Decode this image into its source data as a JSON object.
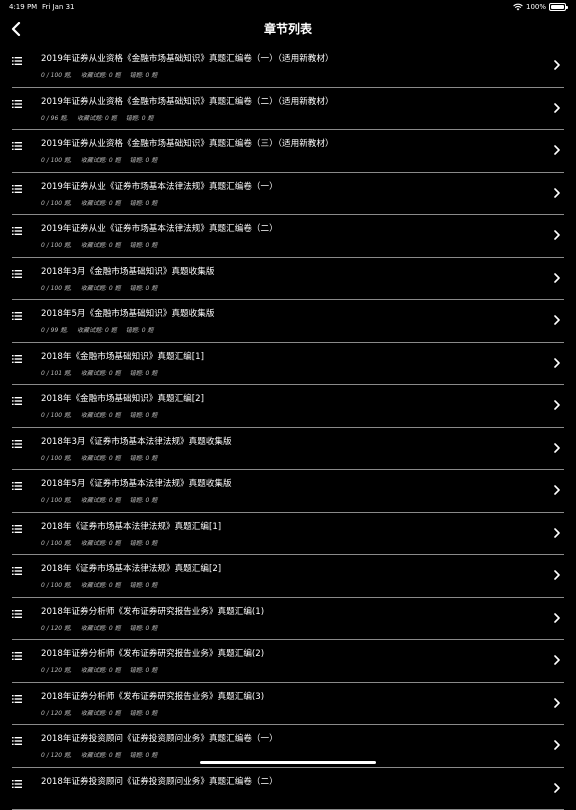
{
  "status": {
    "time": "4:19 PM",
    "date": "Fri Jan 31",
    "battery": "100%"
  },
  "nav": {
    "title": "章节列表"
  },
  "chapters": [
    {
      "title": "2019年证券从业资格《金融市场基础知识》真题汇编卷（一）（适用新教材）",
      "progress": "0 / 100 题,",
      "favorites": "收藏试题: 0 题",
      "wrong": "错题: 0 题"
    },
    {
      "title": "2019年证券从业资格《金融市场基础知识》真题汇编卷（二）（适用新教材）",
      "progress": "0 / 96 题,",
      "favorites": "收藏试题: 0 题",
      "wrong": "错题: 0 题"
    },
    {
      "title": "2019年证券从业资格《金融市场基础知识》真题汇编卷（三）（适用新教材）",
      "progress": "0 / 100 题,",
      "favorites": "收藏试题: 0 题",
      "wrong": "错题: 0 题"
    },
    {
      "title": "2019年证券从业《证券市场基本法律法规》真题汇编卷（一）",
      "progress": "0 / 100 题,",
      "favorites": "收藏试题: 0 题",
      "wrong": "错题: 0 题"
    },
    {
      "title": "2019年证券从业《证券市场基本法律法规》真题汇编卷（二）",
      "progress": "0 / 100 题,",
      "favorites": "收藏试题: 0 题",
      "wrong": "错题: 0 题"
    },
    {
      "title": "2018年3月《金融市场基础知识》真题收集版",
      "progress": "0 / 100 题,",
      "favorites": "收藏试题: 0 题",
      "wrong": "错题: 0 题"
    },
    {
      "title": "2018年5月《金融市场基础知识》真题收集版",
      "progress": "0 / 99 题,",
      "favorites": "收藏试题: 0 题",
      "wrong": "错题: 0 题"
    },
    {
      "title": "2018年《金融市场基础知识》真题汇编[1]",
      "progress": "0 / 101 题,",
      "favorites": "收藏试题: 0 题",
      "wrong": "错题: 0 题"
    },
    {
      "title": "2018年《金融市场基础知识》真题汇编[2]",
      "progress": "0 / 100 题,",
      "favorites": "收藏试题: 0 题",
      "wrong": "错题: 0 题"
    },
    {
      "title": "2018年3月《证券市场基本法律法规》真题收集版",
      "progress": "0 / 100 题,",
      "favorites": "收藏试题: 0 题",
      "wrong": "错题: 0 题"
    },
    {
      "title": "2018年5月《证券市场基本法律法规》真题收集版",
      "progress": "0 / 100 题,",
      "favorites": "收藏试题: 0 题",
      "wrong": "错题: 0 题"
    },
    {
      "title": "2018年《证券市场基本法律法规》真题汇编[1]",
      "progress": "0 / 100 题,",
      "favorites": "收藏试题: 0 题",
      "wrong": "错题: 0 题"
    },
    {
      "title": "2018年《证券市场基本法律法规》真题汇编[2]",
      "progress": "0 / 100 题,",
      "favorites": "收藏试题: 0 题",
      "wrong": "错题: 0 题"
    },
    {
      "title": "2018年证券分析师《发布证券研究报告业务》真题汇编(1)",
      "progress": "0 / 120 题,",
      "favorites": "收藏试题: 0 题",
      "wrong": "错题: 0 题"
    },
    {
      "title": "2018年证券分析师《发布证券研究报告业务》真题汇编(2)",
      "progress": "0 / 120 题,",
      "favorites": "收藏试题: 0 题",
      "wrong": "错题: 0 题"
    },
    {
      "title": "2018年证券分析师《发布证券研究报告业务》真题汇编(3)",
      "progress": "0 / 120 题,",
      "favorites": "收藏试题: 0 题",
      "wrong": "错题: 0 题"
    },
    {
      "title": "2018年证券投资顾问《证券投资顾问业务》真题汇编卷（一）",
      "progress": "0 / 120 题,",
      "favorites": "收藏试题: 0 题",
      "wrong": "错题: 0 题"
    },
    {
      "title": "2018年证券投资顾问《证券投资顾问业务》真题汇编卷（二）",
      "progress": "",
      "favorites": "",
      "wrong": ""
    }
  ]
}
